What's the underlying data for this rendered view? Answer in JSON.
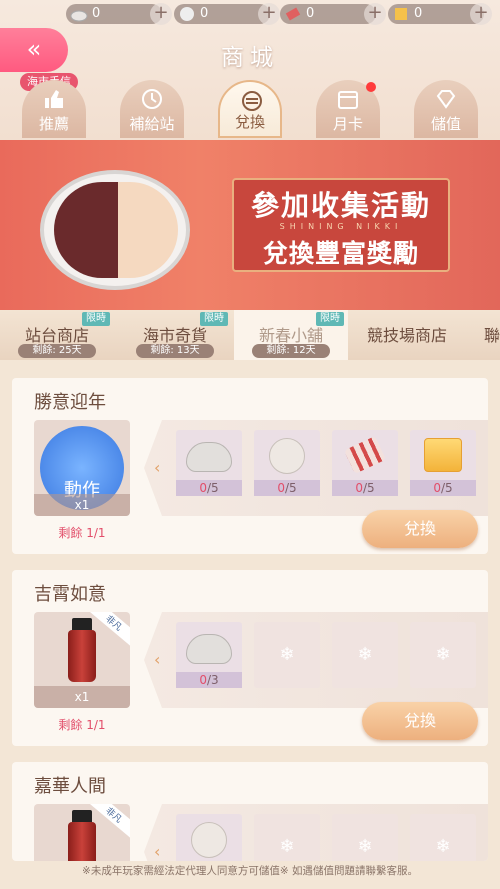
{
  "currency": [
    {
      "icon": "rock-icon",
      "value": "0"
    },
    {
      "icon": "ball-icon",
      "value": "0"
    },
    {
      "icon": "roll-icon",
      "value": "0"
    },
    {
      "icon": "cube-icon",
      "value": "0"
    }
  ],
  "header": {
    "title": "商城",
    "badge": "海市手信",
    "tabs": [
      {
        "label": "推薦",
        "icon": "recommend-icon"
      },
      {
        "label": "補給站",
        "icon": "supply-icon"
      },
      {
        "label": "兌換",
        "icon": "exchange-icon"
      },
      {
        "label": "月卡",
        "icon": "calendar-icon"
      },
      {
        "label": "儲值",
        "icon": "diamond-icon"
      }
    ]
  },
  "banner": {
    "line1": "參加收集活動",
    "sub": "SHINING NIKKI",
    "line2": "兌換豐富獎勵"
  },
  "shop_tabs": [
    {
      "name": "站台商店",
      "limit": "限時",
      "remaining": "剩餘: 25天"
    },
    {
      "name": "海市奇貨",
      "limit": "限時",
      "remaining": "剩餘: 13天"
    },
    {
      "name": "新春小舖",
      "limit": "限時",
      "remaining": "剩餘: 12天"
    },
    {
      "name": "競技場商店"
    },
    {
      "name": "聯"
    }
  ],
  "items": [
    {
      "title": "勝意迎年",
      "reward_label": "動作",
      "reward_count": "x1",
      "remaining": "剩餘 1/1",
      "reqs": [
        {
          "have": "0",
          "need": "/5"
        },
        {
          "have": "0",
          "need": "/5"
        },
        {
          "have": "0",
          "need": "/5"
        },
        {
          "have": "0",
          "need": "/5"
        }
      ],
      "button": "兌換"
    },
    {
      "title": "吉霄如意",
      "reward_tag": "非凡",
      "reward_count": "x1",
      "remaining": "剩餘 1/1",
      "reqs": [
        {
          "have": "0",
          "need": "/3"
        }
      ],
      "button": "兌換"
    },
    {
      "title": "嘉華人間",
      "reward_tag": "非凡"
    }
  ],
  "footer": "※未成年玩家需經法定代理人同意方可儲值※ 如遇儲值問題請聯繫客服。",
  "colors": {
    "accent": "#e24e6a",
    "button": "#edb07e",
    "badge": "#5fb8b5"
  }
}
